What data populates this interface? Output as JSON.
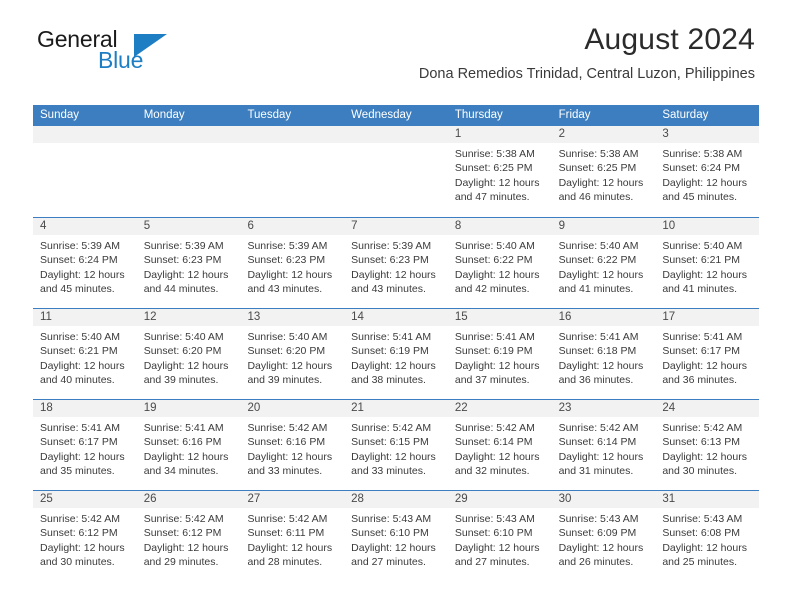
{
  "brand": {
    "name_part1": "General",
    "name_part2": "Blue",
    "accent_color": "#1d7ec4",
    "triangle_icon": "triangle-icon"
  },
  "header": {
    "month_title": "August 2024",
    "location": "Dona Remedios Trinidad, Central Luzon, Philippines"
  },
  "calendar": {
    "header_bg": "#3c7ebf",
    "daynum_bg": "#f2f2f2",
    "weekdays": [
      "Sunday",
      "Monday",
      "Tuesday",
      "Wednesday",
      "Thursday",
      "Friday",
      "Saturday"
    ],
    "weeks": [
      [
        {
          "day": "",
          "lines": []
        },
        {
          "day": "",
          "lines": []
        },
        {
          "day": "",
          "lines": []
        },
        {
          "day": "",
          "lines": []
        },
        {
          "day": "1",
          "lines": [
            "Sunrise: 5:38 AM",
            "Sunset: 6:25 PM",
            "Daylight: 12 hours",
            "and 47 minutes."
          ]
        },
        {
          "day": "2",
          "lines": [
            "Sunrise: 5:38 AM",
            "Sunset: 6:25 PM",
            "Daylight: 12 hours",
            "and 46 minutes."
          ]
        },
        {
          "day": "3",
          "lines": [
            "Sunrise: 5:38 AM",
            "Sunset: 6:24 PM",
            "Daylight: 12 hours",
            "and 45 minutes."
          ]
        }
      ],
      [
        {
          "day": "4",
          "lines": [
            "Sunrise: 5:39 AM",
            "Sunset: 6:24 PM",
            "Daylight: 12 hours",
            "and 45 minutes."
          ]
        },
        {
          "day": "5",
          "lines": [
            "Sunrise: 5:39 AM",
            "Sunset: 6:23 PM",
            "Daylight: 12 hours",
            "and 44 minutes."
          ]
        },
        {
          "day": "6",
          "lines": [
            "Sunrise: 5:39 AM",
            "Sunset: 6:23 PM",
            "Daylight: 12 hours",
            "and 43 minutes."
          ]
        },
        {
          "day": "7",
          "lines": [
            "Sunrise: 5:39 AM",
            "Sunset: 6:23 PM",
            "Daylight: 12 hours",
            "and 43 minutes."
          ]
        },
        {
          "day": "8",
          "lines": [
            "Sunrise: 5:40 AM",
            "Sunset: 6:22 PM",
            "Daylight: 12 hours",
            "and 42 minutes."
          ]
        },
        {
          "day": "9",
          "lines": [
            "Sunrise: 5:40 AM",
            "Sunset: 6:22 PM",
            "Daylight: 12 hours",
            "and 41 minutes."
          ]
        },
        {
          "day": "10",
          "lines": [
            "Sunrise: 5:40 AM",
            "Sunset: 6:21 PM",
            "Daylight: 12 hours",
            "and 41 minutes."
          ]
        }
      ],
      [
        {
          "day": "11",
          "lines": [
            "Sunrise: 5:40 AM",
            "Sunset: 6:21 PM",
            "Daylight: 12 hours",
            "and 40 minutes."
          ]
        },
        {
          "day": "12",
          "lines": [
            "Sunrise: 5:40 AM",
            "Sunset: 6:20 PM",
            "Daylight: 12 hours",
            "and 39 minutes."
          ]
        },
        {
          "day": "13",
          "lines": [
            "Sunrise: 5:40 AM",
            "Sunset: 6:20 PM",
            "Daylight: 12 hours",
            "and 39 minutes."
          ]
        },
        {
          "day": "14",
          "lines": [
            "Sunrise: 5:41 AM",
            "Sunset: 6:19 PM",
            "Daylight: 12 hours",
            "and 38 minutes."
          ]
        },
        {
          "day": "15",
          "lines": [
            "Sunrise: 5:41 AM",
            "Sunset: 6:19 PM",
            "Daylight: 12 hours",
            "and 37 minutes."
          ]
        },
        {
          "day": "16",
          "lines": [
            "Sunrise: 5:41 AM",
            "Sunset: 6:18 PM",
            "Daylight: 12 hours",
            "and 36 minutes."
          ]
        },
        {
          "day": "17",
          "lines": [
            "Sunrise: 5:41 AM",
            "Sunset: 6:17 PM",
            "Daylight: 12 hours",
            "and 36 minutes."
          ]
        }
      ],
      [
        {
          "day": "18",
          "lines": [
            "Sunrise: 5:41 AM",
            "Sunset: 6:17 PM",
            "Daylight: 12 hours",
            "and 35 minutes."
          ]
        },
        {
          "day": "19",
          "lines": [
            "Sunrise: 5:41 AM",
            "Sunset: 6:16 PM",
            "Daylight: 12 hours",
            "and 34 minutes."
          ]
        },
        {
          "day": "20",
          "lines": [
            "Sunrise: 5:42 AM",
            "Sunset: 6:16 PM",
            "Daylight: 12 hours",
            "and 33 minutes."
          ]
        },
        {
          "day": "21",
          "lines": [
            "Sunrise: 5:42 AM",
            "Sunset: 6:15 PM",
            "Daylight: 12 hours",
            "and 33 minutes."
          ]
        },
        {
          "day": "22",
          "lines": [
            "Sunrise: 5:42 AM",
            "Sunset: 6:14 PM",
            "Daylight: 12 hours",
            "and 32 minutes."
          ]
        },
        {
          "day": "23",
          "lines": [
            "Sunrise: 5:42 AM",
            "Sunset: 6:14 PM",
            "Daylight: 12 hours",
            "and 31 minutes."
          ]
        },
        {
          "day": "24",
          "lines": [
            "Sunrise: 5:42 AM",
            "Sunset: 6:13 PM",
            "Daylight: 12 hours",
            "and 30 minutes."
          ]
        }
      ],
      [
        {
          "day": "25",
          "lines": [
            "Sunrise: 5:42 AM",
            "Sunset: 6:12 PM",
            "Daylight: 12 hours",
            "and 30 minutes."
          ]
        },
        {
          "day": "26",
          "lines": [
            "Sunrise: 5:42 AM",
            "Sunset: 6:12 PM",
            "Daylight: 12 hours",
            "and 29 minutes."
          ]
        },
        {
          "day": "27",
          "lines": [
            "Sunrise: 5:42 AM",
            "Sunset: 6:11 PM",
            "Daylight: 12 hours",
            "and 28 minutes."
          ]
        },
        {
          "day": "28",
          "lines": [
            "Sunrise: 5:43 AM",
            "Sunset: 6:10 PM",
            "Daylight: 12 hours",
            "and 27 minutes."
          ]
        },
        {
          "day": "29",
          "lines": [
            "Sunrise: 5:43 AM",
            "Sunset: 6:10 PM",
            "Daylight: 12 hours",
            "and 27 minutes."
          ]
        },
        {
          "day": "30",
          "lines": [
            "Sunrise: 5:43 AM",
            "Sunset: 6:09 PM",
            "Daylight: 12 hours",
            "and 26 minutes."
          ]
        },
        {
          "day": "31",
          "lines": [
            "Sunrise: 5:43 AM",
            "Sunset: 6:08 PM",
            "Daylight: 12 hours",
            "and 25 minutes."
          ]
        }
      ]
    ]
  }
}
